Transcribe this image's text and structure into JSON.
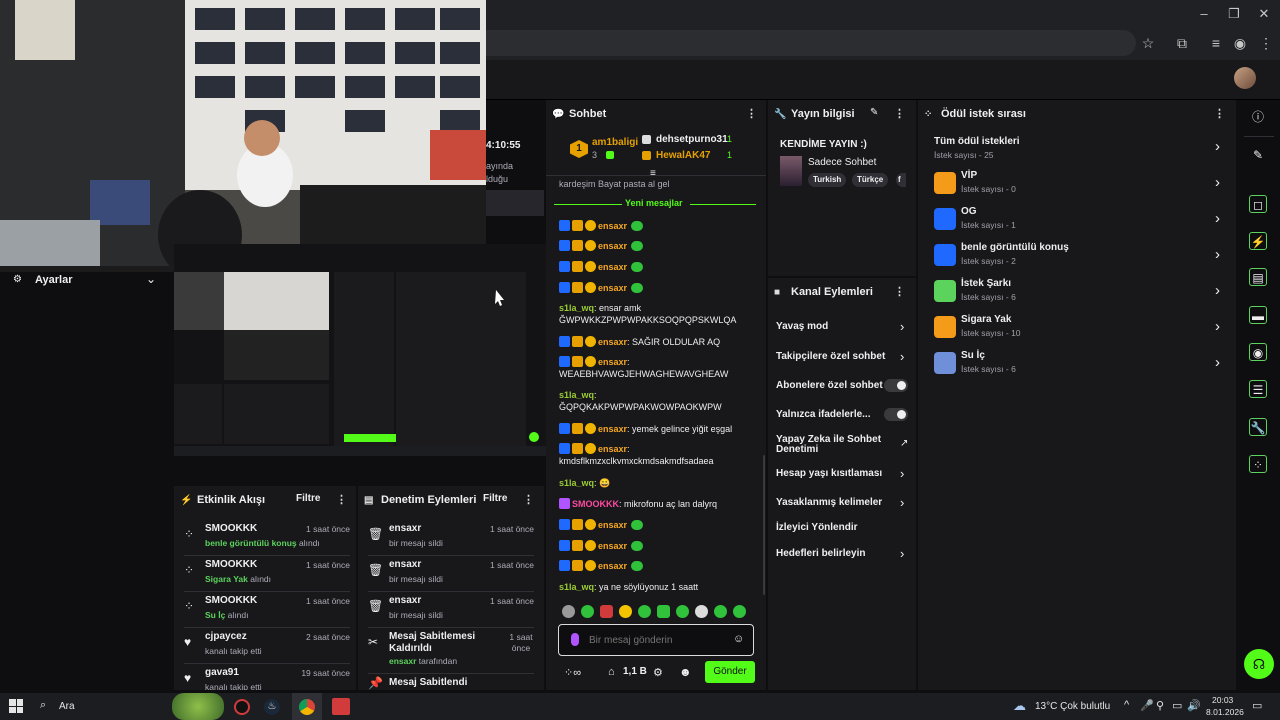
{
  "browser": {
    "window_controls": [
      "–",
      "❐",
      "✕"
    ]
  },
  "video": {
    "settings_label": "Ayarlar",
    "clock_text": "4:10:55",
    "side_text_1": "ayında",
    "side_text_2": "lduğu"
  },
  "chat": {
    "header": "Sohbet",
    "leaders": [
      {
        "rank": "1",
        "name": "am1baligi",
        "count": "3"
      },
      {
        "name": "dehsetpurno31",
        "count": "1"
      },
      {
        "name": "HewalAK47",
        "count": "1"
      }
    ],
    "cut_line": "kardeşim Bayat pasta al gel",
    "new_messages_label": "Yeni mesajlar",
    "messages": [
      {
        "user": "ensaxr",
        "text": ""
      },
      {
        "user": "ensaxr",
        "text": ""
      },
      {
        "user": "ensaxr",
        "text": ""
      },
      {
        "user": "ensaxr",
        "text": ""
      },
      {
        "user": "s1la_wq",
        "text": "ensar amk ĞWPWKKZPWPWPAKKSOQPQPSKWLQA"
      },
      {
        "user": "ensaxr",
        "text": "SAĞIR OLDULAR AQ"
      },
      {
        "user": "ensaxr",
        "text": "WEAEBHVAWGJEHWAGHEWAVGHEAW"
      },
      {
        "user": "s1la_wq",
        "text": "ĞQPQKAKPWPWPAKWOWPAOKWPW"
      },
      {
        "user": "ensaxr",
        "text": "yemek gelince yiğit eşgal"
      },
      {
        "user": "ensaxr",
        "text": "kmdsflkmzxclkvmxckmdsakmdfsadaea"
      },
      {
        "user": "s1la_wq",
        "text": "😀"
      },
      {
        "user": "SMOOKKK",
        "text": "mikrofonu aç lan dalyrq"
      },
      {
        "user": "ensaxr",
        "text": ""
      },
      {
        "user": "ensaxr",
        "text": ""
      },
      {
        "user": "ensaxr",
        "text": ""
      },
      {
        "user": "s1la_wq",
        "text": "ya ne söylüyonuz 1 saatt"
      }
    ],
    "input_placeholder": "Bir mesaj gönderin",
    "points": "1,1 B",
    "send_label": "Gönder"
  },
  "stream_info": {
    "header": "Yayın bilgisi",
    "title": "KENDİME YAYIN :)",
    "category": "Sadece Sohbet",
    "tags": [
      "Turkish",
      "Türkçe",
      "f"
    ]
  },
  "channel_actions": {
    "header": "Kanal Eylemleri",
    "items": [
      {
        "label": "Yavaş mod",
        "control": "chevron"
      },
      {
        "label": "Takipçilere özel sohbet",
        "control": "chevron"
      },
      {
        "label": "Abonelere özel sohbet",
        "control": "toggle"
      },
      {
        "label": "Yalnızca ifadelerle...",
        "control": "toggle"
      },
      {
        "label": "Yapay Zeka ile Sohbet Denetimi",
        "control": "external"
      },
      {
        "label": "Hesap yaşı kısıtlaması",
        "control": "chevron"
      },
      {
        "label": "Yasaklanmış kelimeler",
        "control": "chevron"
      },
      {
        "label": "İzleyici Yönlendir",
        "control": "none"
      },
      {
        "label": "Hedefleri belirleyin",
        "control": "chevron"
      }
    ]
  },
  "rewards": {
    "header": "Ödül istek sırası",
    "all_title": "Tüm ödül istekleri",
    "all_sub": "İstek sayısı - 25",
    "items": [
      {
        "title": "VİP",
        "sub": "İstek sayısı - 0",
        "color": "#f59b1a"
      },
      {
        "title": "OG",
        "sub": "İstek sayısı - 1",
        "color": "#1f69ff"
      },
      {
        "title": "benle görüntülü konuş",
        "sub": "İstek sayısı - 2",
        "color": "#1f69ff"
      },
      {
        "title": "İstek Şarkı",
        "sub": "İstek sayısı - 6",
        "color": "#5cd35c"
      },
      {
        "title": "Sigara Yak",
        "sub": "İstek sayısı - 10",
        "color": "#f59b1a"
      },
      {
        "title": "Su İç",
        "sub": "İstek sayısı - 6",
        "color": "#6f8fd8"
      }
    ]
  },
  "activity": {
    "header": "Etkinlik Akışı",
    "filter_label": "Filtre",
    "items": [
      {
        "name": "SMOOKKK",
        "highlight": "benle görüntülü konuş",
        "sub": " alındı",
        "time": "1 saat önce",
        "icon": "reward"
      },
      {
        "name": "SMOOKKK",
        "highlight": "Sigara Yak",
        "sub": " alındı",
        "time": "1 saat önce",
        "icon": "reward"
      },
      {
        "name": "SMOOKKK",
        "highlight": "Su İç",
        "sub": " alındı",
        "time": "1 saat önce",
        "icon": "reward"
      },
      {
        "name": "cjpaycez",
        "highlight": "",
        "sub": "kanalı takip etti",
        "time": "2 saat önce",
        "icon": "heart"
      },
      {
        "name": "gava91",
        "highlight": "",
        "sub": "kanalı takip etti",
        "time": "19 saat önce",
        "icon": "heart"
      }
    ]
  },
  "modlog": {
    "header": "Denetim Eylemleri",
    "filter_label": "Filtre",
    "items": [
      {
        "name": "ensaxr",
        "sub": "bir mesajı sildi",
        "time": "1 saat önce"
      },
      {
        "name": "ensaxr",
        "sub": "bir mesajı sildi",
        "time": "1 saat önce"
      },
      {
        "name": "ensaxr",
        "sub": "bir mesajı sildi",
        "time": "1 saat önce"
      },
      {
        "name": "Mesaj Sabitlemesi Kaldırıldı",
        "sub_user": "ensaxr",
        "sub": " tarafından",
        "time": "1 saat önce"
      },
      {
        "name": "Mesaj Sabitlendi",
        "sub": "",
        "time": ""
      }
    ]
  },
  "taskbar": {
    "search_label": "Ara",
    "weather": "13°C  Çok bulutlu",
    "time": "20:03",
    "date": "8.01.2026"
  },
  "colors": {
    "accent_green": "#53fc18",
    "kick_green": "#5cd35c",
    "panel_bg": "#18181b",
    "app_bg": "#0e0e10"
  }
}
